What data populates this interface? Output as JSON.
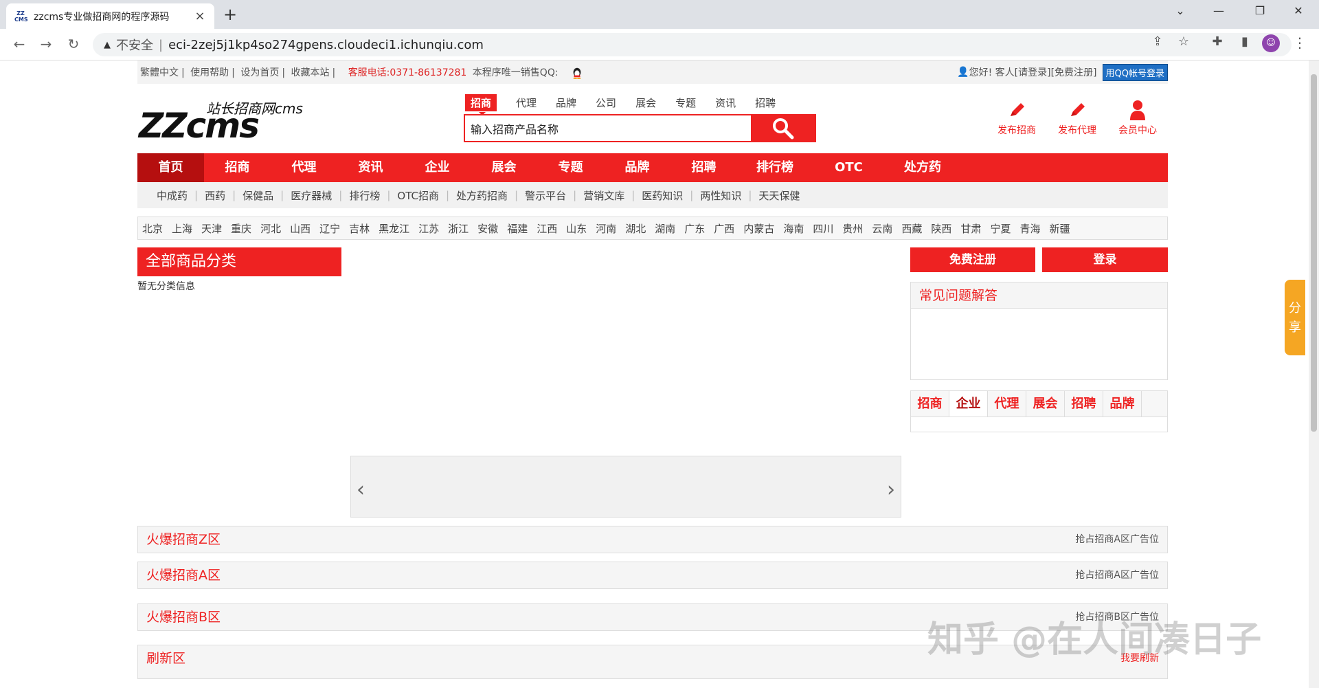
{
  "browser": {
    "tab_title": "zzcms专业做招商网的程序源码",
    "favicon_text": "ZZ CMS",
    "security_label": "不安全",
    "url": "eci-2zej5j1kp4so274gpens.cloudeci1.ichunqiu.com"
  },
  "topbar": {
    "links": [
      "繁體中文",
      "使用帮助",
      "设为首页",
      "收藏本站"
    ],
    "phone": "客服电话:0371-86137281",
    "sale_qq": "本程序唯一销售QQ:",
    "greeting": "您好! 客人",
    "login_link": "[请登录]",
    "register_link": "[免费注册]",
    "qq_login": "用QQ帐号登录"
  },
  "logo": {
    "big": "ZZcms",
    "small": "站长招商网cms"
  },
  "search": {
    "tabs": [
      "招商",
      "代理",
      "品牌",
      "公司",
      "展会",
      "专题",
      "资讯",
      "招聘"
    ],
    "active_tab": "招商",
    "value": "输入招商产品名称"
  },
  "quick_links": [
    "发布招商",
    "发布代理",
    "会员中心"
  ],
  "main_nav": [
    "首页",
    "招商",
    "代理",
    "资讯",
    "企业",
    "展会",
    "专题",
    "品牌",
    "招聘",
    "排行榜",
    "OTC",
    "处方药"
  ],
  "sub_nav": [
    "中成药",
    "西药",
    "保健品",
    "医疗器械",
    "排行榜",
    "OTC招商",
    "处方药招商",
    "警示平台",
    "营销文库",
    "医药知识",
    "两性知识",
    "天天保健"
  ],
  "cities": [
    "北京",
    "上海",
    "天津",
    "重庆",
    "河北",
    "山西",
    "辽宁",
    "吉林",
    "黑龙江",
    "江苏",
    "浙江",
    "安徽",
    "福建",
    "江西",
    "山东",
    "河南",
    "湖北",
    "湖南",
    "广东",
    "广西",
    "内蒙古",
    "海南",
    "四川",
    "贵州",
    "云南",
    "西藏",
    "陕西",
    "甘肃",
    "宁夏",
    "青海",
    "新疆"
  ],
  "category": {
    "title": "全部商品分类",
    "empty": "暂无分类信息"
  },
  "right": {
    "register_btn": "免费注册",
    "login_btn": "登录",
    "faq_title": "常见问题解答",
    "tabs": [
      "招商",
      "企业",
      "代理",
      "展会",
      "招聘",
      "品牌"
    ],
    "active_tab": "企业"
  },
  "zones": [
    {
      "title": "火爆招商Z区",
      "right": "抢占招商A区广告位"
    },
    {
      "title": "火爆招商A区",
      "right": "抢占招商A区广告位"
    },
    {
      "title": "火爆招商B区",
      "right": "抢占招商B区广告位"
    },
    {
      "title": "刷新区",
      "right": "我要刷新"
    }
  ],
  "share": "分享",
  "watermark": "知乎 @在人间凑日子"
}
